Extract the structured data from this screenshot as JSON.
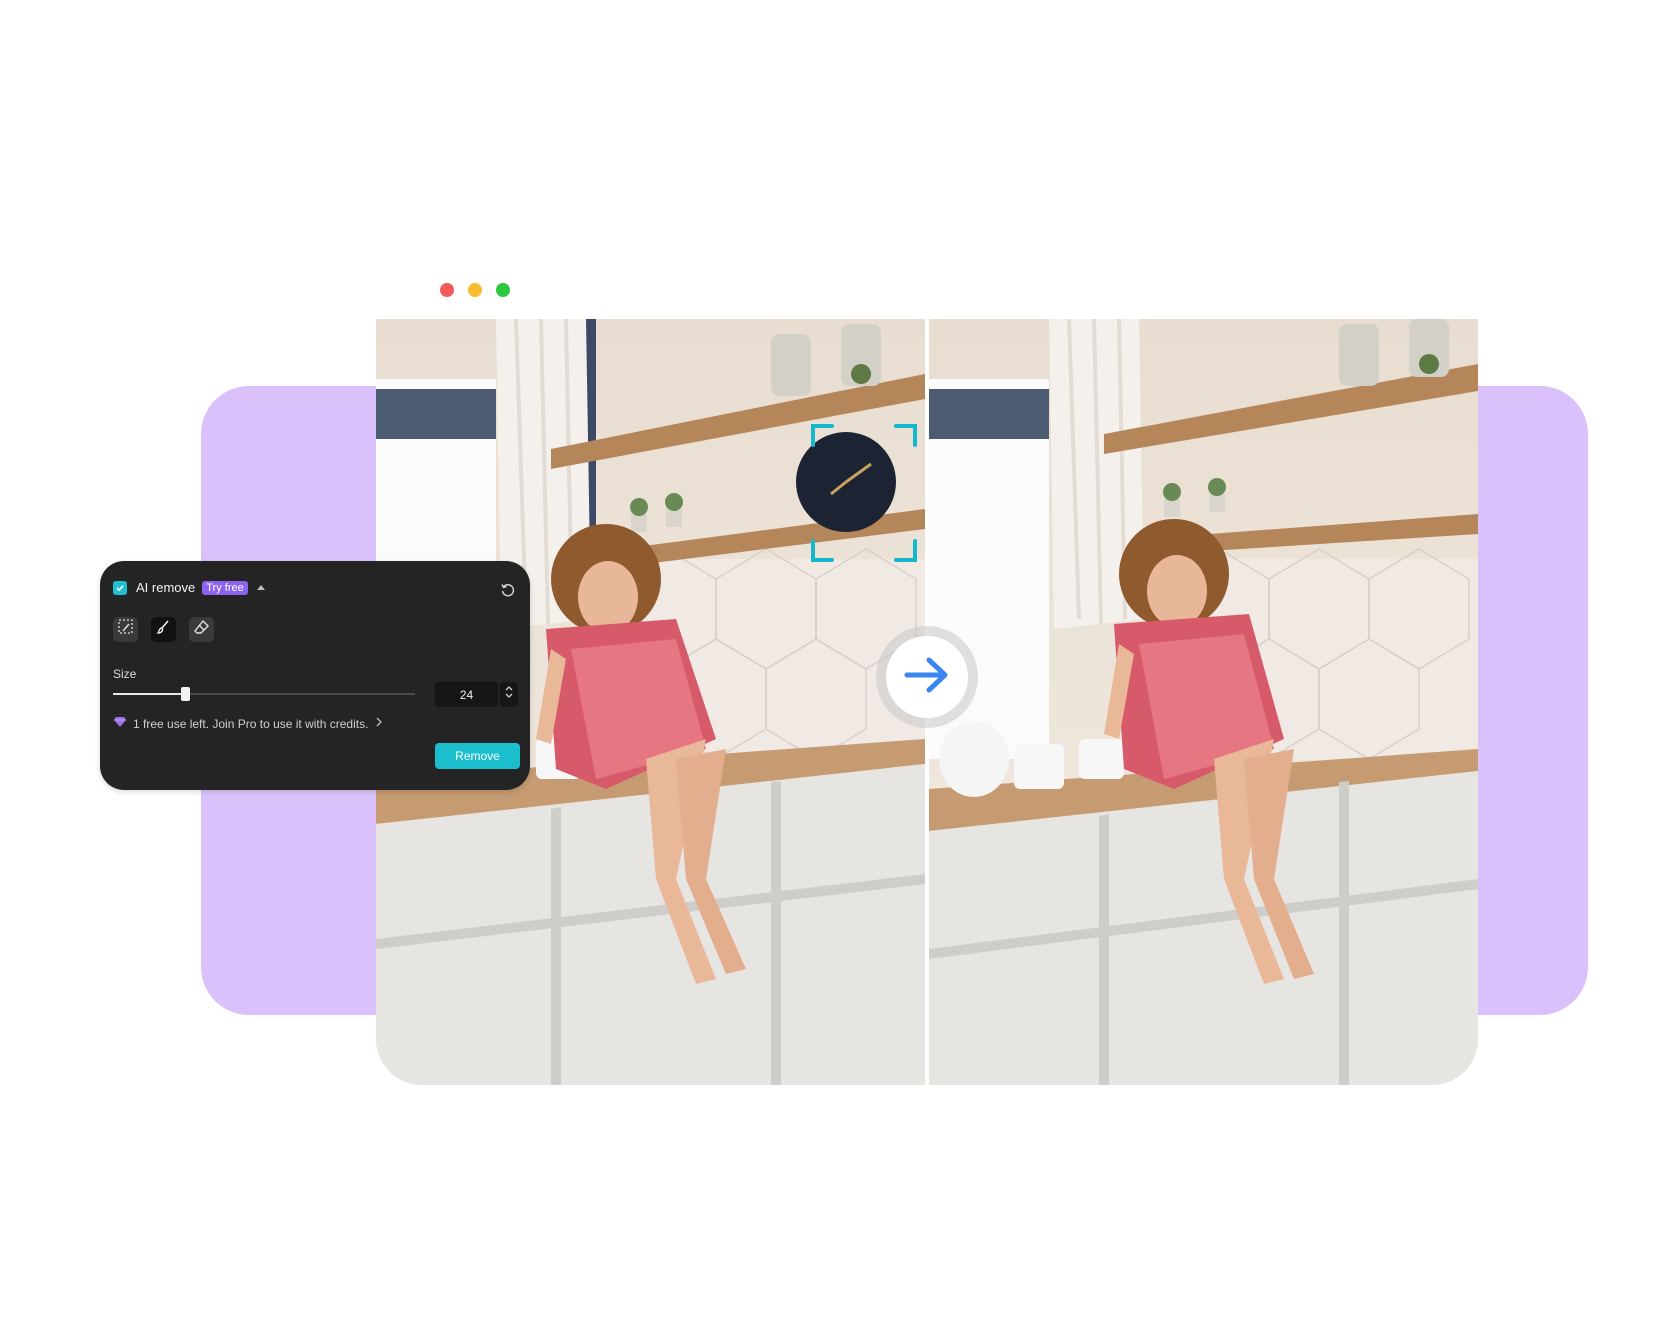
{
  "window": {
    "controls": [
      {
        "name": "close",
        "color": "#f25b57"
      },
      {
        "name": "minimize",
        "color": "#f8bb2f"
      },
      {
        "name": "maximize",
        "color": "#2bc840"
      }
    ]
  },
  "panel": {
    "title": "AI remove",
    "badge": "Try free",
    "tools": [
      "rect-select-icon",
      "brush-icon",
      "eraser-icon"
    ],
    "size_label": "Size",
    "size_value": "24",
    "size_level": 0.24,
    "info_text": "1 free use left. Join Pro to use it with credits.",
    "remove_button": "Remove"
  },
  "compare": {
    "before_image": "kitchen-photo-with-clock",
    "after_image": "kitchen-photo-clock-removed",
    "arrow_icon": "arrow-right-icon"
  },
  "colors": {
    "accent": "#1bbecd",
    "badge": "#8c63ee",
    "panel_bg": "#242424",
    "backdrop": "#dbc1fb",
    "arrow": "#3a86f0"
  }
}
